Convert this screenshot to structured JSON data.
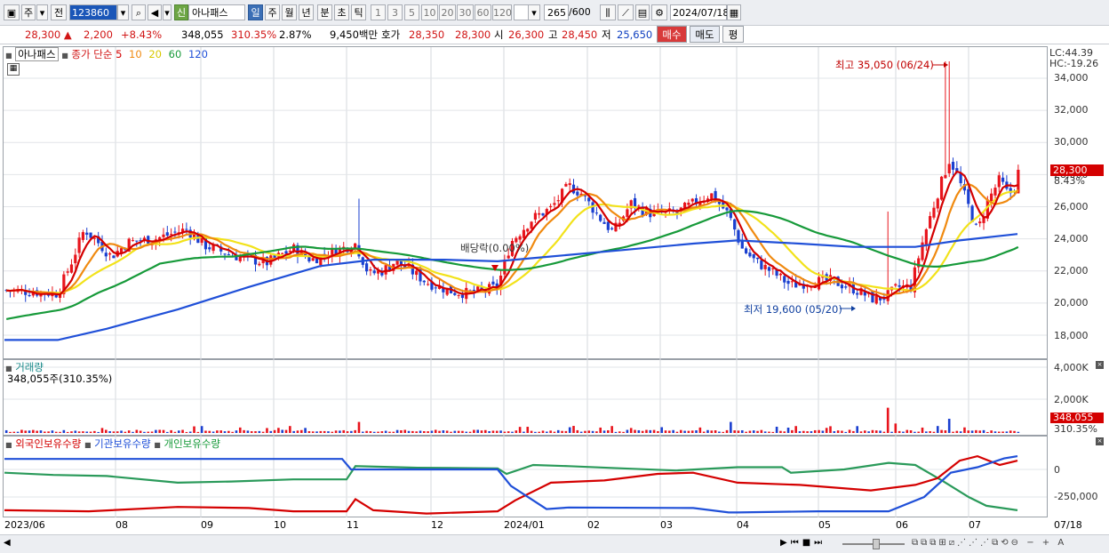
{
  "toolbar": {
    "market": "주",
    "prev": "전",
    "code": "123860",
    "badge": "신",
    "name": "아나패스",
    "periods": [
      "일",
      "주",
      "월",
      "년",
      "분",
      "초",
      "틱"
    ],
    "active_period": "일",
    "intervals": [
      "1",
      "3",
      "5",
      "10",
      "20",
      "30",
      "60",
      "120"
    ],
    "count": "265",
    "count_total": "/600",
    "date": "2024/07/18"
  },
  "quote": {
    "price": "28,300",
    "change": "2,200",
    "change_pct": "+8.43%",
    "volume": "348,055",
    "volume_ratio": "310.35%",
    "turnover": "2.87%",
    "amount": "9,450백만",
    "bid_label": "호가",
    "bid1": "28,350",
    "bid2": "28,300",
    "open_label": "시",
    "open": "26,300",
    "high_label": "고",
    "high": "28,450",
    "low_label": "저",
    "low": "25,650",
    "buy": "매수",
    "sell": "매도",
    "eval": "평"
  },
  "price_panel": {
    "legend_name": "아나패스",
    "legend_ma": "종가 단순",
    "ma_periods": [
      "5",
      "10",
      "20",
      "60",
      "120"
    ],
    "ma_colors": [
      "#d40000",
      "#f08a10",
      "#f2e21a",
      "#179a3a",
      "#2050d8"
    ],
    "lc": "LC:44.39",
    "hc": "HC:-19.26",
    "current_price": "28,300",
    "current_pct": "8.43%",
    "high_annotation": "최고 35,050 (06/24)",
    "low_annotation": "최저 19,600 (05/20)",
    "dividend_annotation": "배당락(0.00%)",
    "y_ticks": [
      "34,000",
      "32,000",
      "30,000",
      "28,000",
      "26,000",
      "24,000",
      "22,000",
      "20,000",
      "18,000"
    ]
  },
  "volume_panel": {
    "title": "거래량",
    "value_text": "348,055주(310.35%)",
    "y_ticks": [
      "4,000K",
      "2,000K"
    ],
    "current_volume": "348,055",
    "current_pct": "310.35%"
  },
  "holding_panel": {
    "series_labels": [
      "외국인보유수량",
      "기관보유수량",
      "개인보유수량"
    ],
    "series_colors": [
      "#d40000",
      "#2050d8",
      "#179a3a"
    ],
    "y_ticks": [
      "0",
      "-250,000"
    ]
  },
  "x_axis": {
    "labels": [
      "2023/06",
      "08",
      "09",
      "10",
      "11",
      "12",
      "2024/01",
      "02",
      "03",
      "04",
      "05",
      "06",
      "07",
      "07/18"
    ]
  }
}
